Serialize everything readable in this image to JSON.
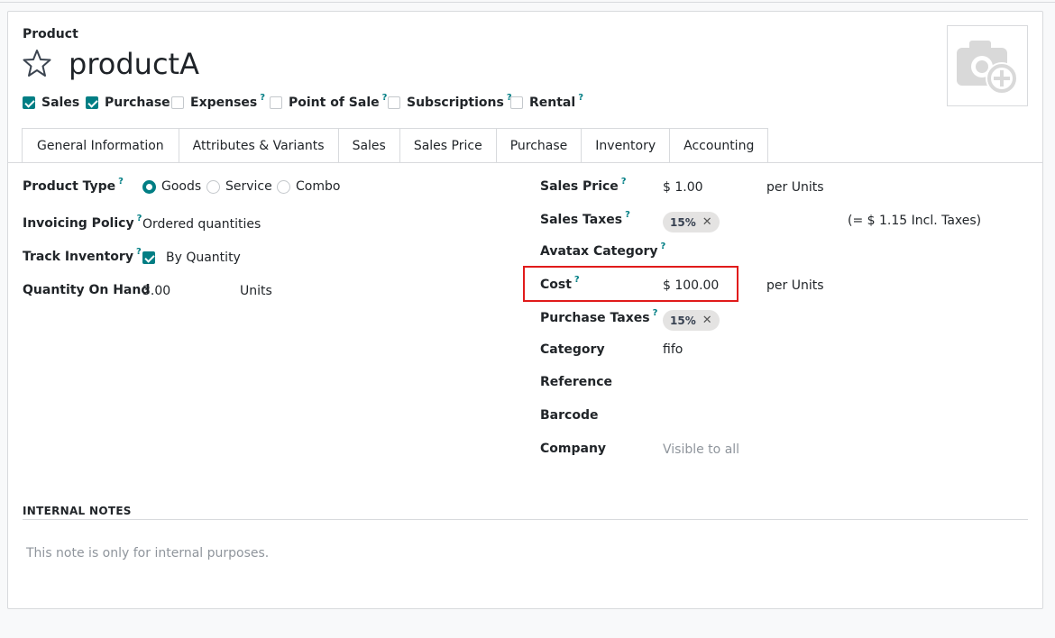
{
  "header": {
    "model_label": "Product",
    "name": "productA"
  },
  "options": {
    "sales": "Sales",
    "purchase": "Purchase",
    "expenses": "Expenses",
    "pos": "Point of Sale",
    "subscriptions": "Subscriptions",
    "rental": "Rental",
    "help": "?"
  },
  "tabs": {
    "general": "General Information",
    "attributes": "Attributes & Variants",
    "sales": "Sales",
    "sales_price": "Sales Price",
    "purchase": "Purchase",
    "inventory": "Inventory",
    "accounting": "Accounting"
  },
  "left": {
    "product_type_label": "Product Type",
    "goods": "Goods",
    "service": "Service",
    "combo": "Combo",
    "invoicing_label": "Invoicing Policy",
    "invoicing_value": "Ordered quantities",
    "track_label": "Track Inventory",
    "track_value": "By Quantity",
    "qty_label": "Quantity On Hand",
    "qty_value": "3.00",
    "qty_unit": "Units"
  },
  "right": {
    "sales_price_label": "Sales Price",
    "sales_price_value": "$ 1.00",
    "per_units": "per Units",
    "sales_taxes_label": "Sales Taxes",
    "tax_tag": "15%",
    "remove_glyph": "✕",
    "incl_taxes": "(= $ 1.15 Incl. Taxes)",
    "avatax_label": "Avatax Category",
    "cost_label": "Cost",
    "cost_value": "$ 100.00",
    "purchase_taxes_label": "Purchase Taxes",
    "category_label": "Category",
    "category_value": "fifo",
    "reference_label": "Reference",
    "barcode_label": "Barcode",
    "company_label": "Company",
    "company_value": "Visible to all"
  },
  "notes": {
    "heading": "INTERNAL NOTES",
    "placeholder": "This note is only for internal purposes."
  },
  "colors": {
    "accent": "#017e84",
    "highlight": "#e11b1b"
  }
}
